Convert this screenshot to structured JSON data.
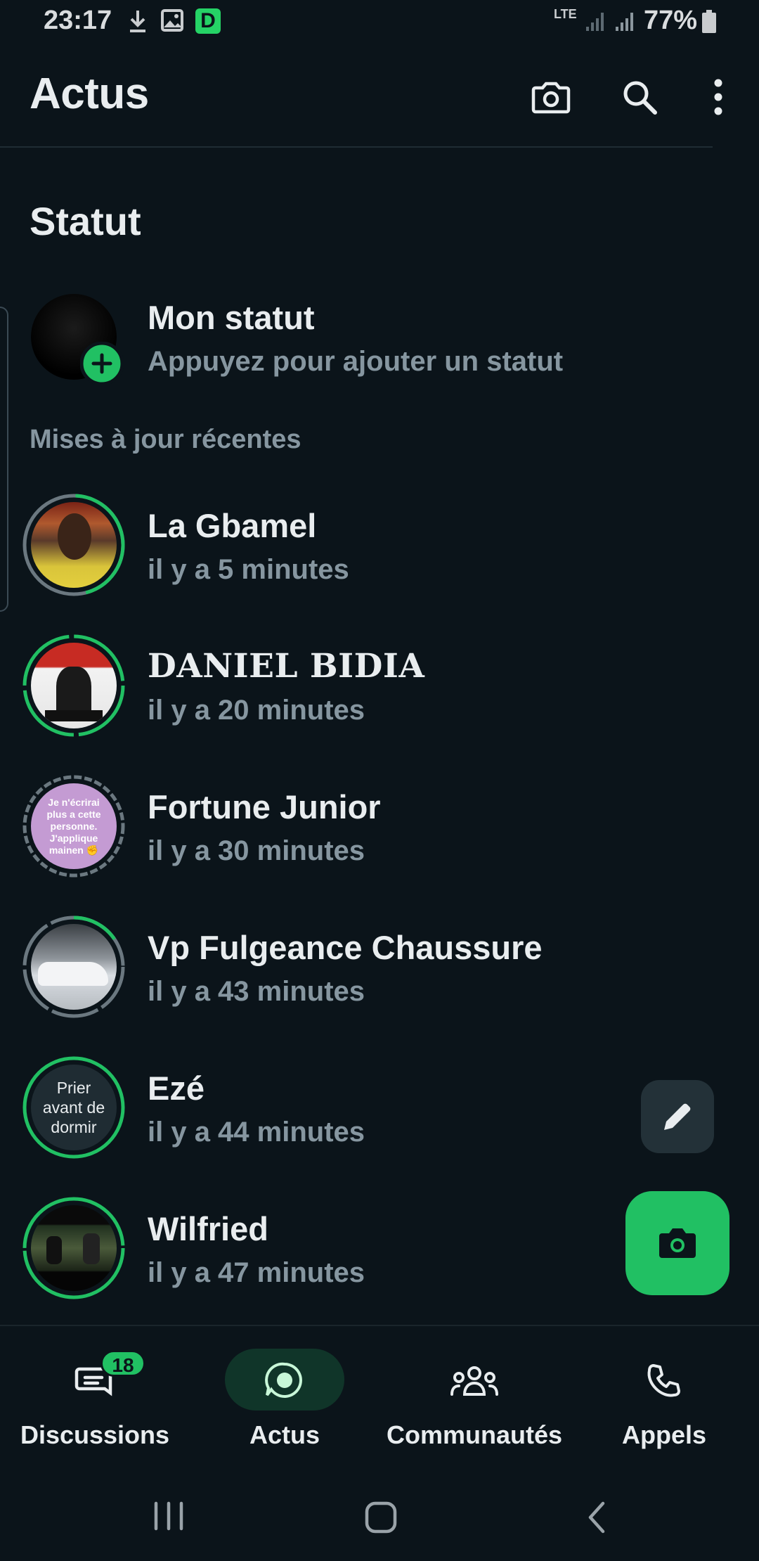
{
  "status_bar": {
    "time": "23:17",
    "network": "LTE",
    "battery": "77%",
    "notification_icons": [
      "download-icon",
      "image-icon",
      "app-d-icon"
    ],
    "app_d_letter": "D"
  },
  "header": {
    "title": "Actus",
    "icons": [
      "camera-icon",
      "search-icon",
      "more-vert-icon"
    ]
  },
  "status_section": {
    "title": "Statut",
    "my_status": {
      "name": "Mon statut",
      "subtitle": "Appuyez pour ajouter un statut"
    },
    "recent_label": "Mises à jour récentes",
    "items": [
      {
        "name": "La Gbamel",
        "time": "il y a 5 minutes"
      },
      {
        "name": "DANIEL BIDIA",
        "time": "il y a 20 minutes"
      },
      {
        "name": "Fortune Junior",
        "time": "il y a 30 minutes",
        "thumb_text": "Je n'écrirai plus a cette personne. J'applique mainen ✊"
      },
      {
        "name": "Vp Fulgeance Chaussure",
        "time": "il y a 43 minutes"
      },
      {
        "name": "Ezé",
        "time": "il y a 44 minutes",
        "thumb_text": "Prier avant de dormir"
      },
      {
        "name": "Wilfried",
        "time": "il y a 47 minutes"
      }
    ]
  },
  "fabs": {
    "edit": "pencil-icon",
    "camera": "camera-icon"
  },
  "bottom_nav": {
    "items": [
      {
        "label": "Discussions",
        "badge": "18"
      },
      {
        "label": "Actus"
      },
      {
        "label": "Communautés"
      },
      {
        "label": "Appels"
      }
    ],
    "active": "Actus"
  },
  "colors": {
    "background": "#0b141a",
    "accent": "#21c063",
    "text_primary": "#e9edef",
    "text_secondary": "#8696a0"
  }
}
